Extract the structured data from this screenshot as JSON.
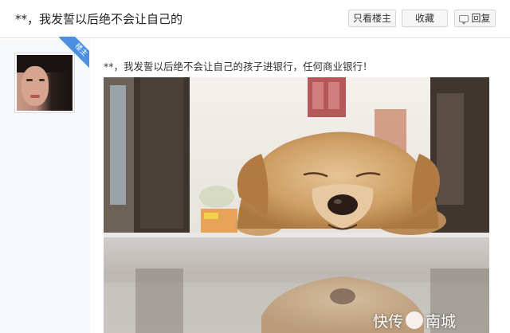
{
  "header": {
    "title": "**，我发誓以后绝不会让自己的",
    "only_op_label": "只看楼主",
    "favorite_label": "收藏",
    "reply_label": "回复"
  },
  "post": {
    "op_badge": "楼主",
    "text": "**，我发誓以后绝不会让自己的孩子进银行，任何商业银行！"
  },
  "watermark": {
    "left_text": "快传",
    "right_text": "南城"
  },
  "colors": {
    "badge": "#4a8fe0",
    "border": "#e3e3e3",
    "sidebar_bg": "#f7f8fa"
  }
}
